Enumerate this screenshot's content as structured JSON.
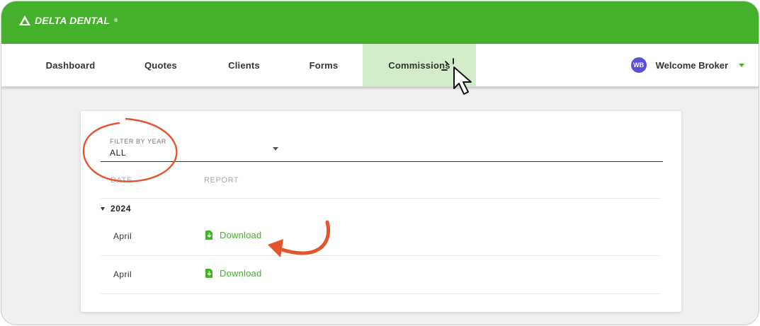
{
  "brand": {
    "name": "DELTA DENTAL",
    "mark": "®",
    "color": "#44b02b"
  },
  "nav": {
    "items": [
      {
        "label": "Dashboard"
      },
      {
        "label": "Quotes"
      },
      {
        "label": "Clients"
      },
      {
        "label": "Forms"
      },
      {
        "label": "Commissions",
        "active": true
      }
    ]
  },
  "user": {
    "initials": "WB",
    "greeting": "Welcome Broker"
  },
  "filter": {
    "label": "FILTER BY YEAR",
    "value": "ALL"
  },
  "table": {
    "columns": [
      "DATE",
      "REPORT"
    ],
    "groups": [
      {
        "year": "2024",
        "rows": [
          {
            "month": "April",
            "action": "Download"
          },
          {
            "month": "April",
            "action": "Download"
          }
        ]
      }
    ]
  },
  "icons": {
    "logo": "delta-triangle-icon",
    "dropdown": "caret-down-icon",
    "file": "file-download-icon",
    "cursor": "pointer-cursor-icon"
  },
  "annotation_color": "#e2562c"
}
